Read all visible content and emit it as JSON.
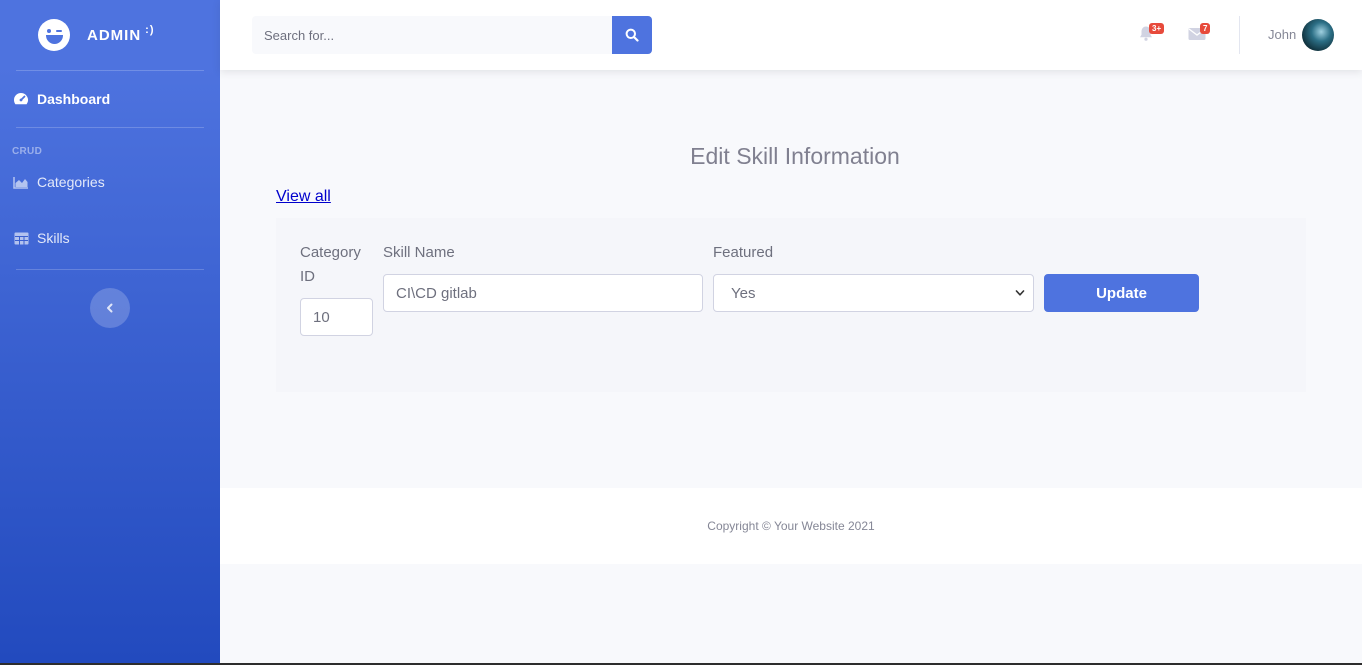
{
  "brand": {
    "name": "ADMIN",
    "suffix": ":)"
  },
  "sidebar": {
    "dashboard": "Dashboard",
    "heading": "CRUD",
    "items": [
      {
        "label": "Categories",
        "icon": "chart-area-icon"
      },
      {
        "label": "Skills",
        "icon": "table-icon"
      }
    ]
  },
  "topbar": {
    "search_placeholder": "Search for...",
    "alerts_badge": "3+",
    "messages_badge": "7",
    "user_name": "John"
  },
  "main": {
    "title": "Edit Skill Information",
    "view_all": "View all",
    "form": {
      "category_label": "Category ID",
      "category_value": "10",
      "skill_label": "Skill Name",
      "skill_value": "CI\\CD gitlab",
      "featured_label": "Featured",
      "featured_value": "Yes",
      "update_label": "Update"
    }
  },
  "footer": {
    "copyright": "Copyright © Your Website 2021"
  },
  "colors": {
    "primary": "#4e73df",
    "danger": "#e74a3b",
    "text_muted": "#858796"
  }
}
